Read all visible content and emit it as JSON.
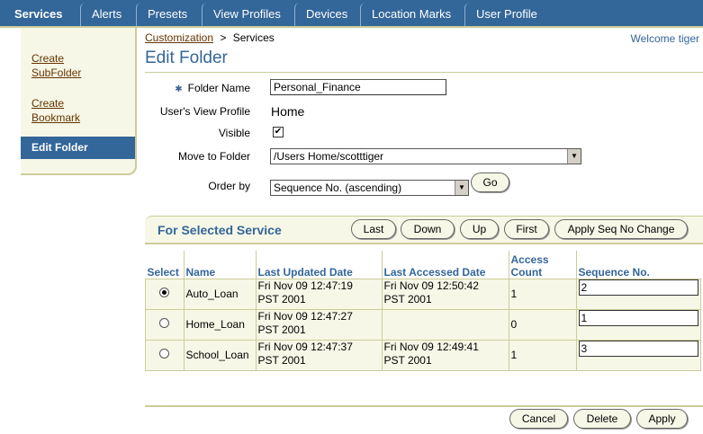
{
  "tabs": [
    {
      "label": "Services",
      "active": true
    },
    {
      "label": "Alerts"
    },
    {
      "label": "Presets"
    },
    {
      "label": "View Profiles"
    },
    {
      "label": "Devices"
    },
    {
      "label": "Location Marks"
    },
    {
      "label": "User Profile"
    }
  ],
  "sidenav": {
    "create_subfolder_1": "Create",
    "create_subfolder_2": "SubFolder",
    "create_bookmark_1": "Create",
    "create_bookmark_2": "Bookmark",
    "active": "Edit Folder"
  },
  "breadcrumb": {
    "link": "Customization",
    "sep": ">",
    "current": "Services"
  },
  "welcome": "Welcome tiger",
  "page_title": "Edit Folder",
  "form": {
    "folder_name_label": "Folder Name",
    "folder_name_value": "Personal_Finance",
    "view_profile_label": "User's View Profile",
    "view_profile_value": "Home",
    "visible_label": "Visible",
    "visible_checked": "✔",
    "move_label": "Move to Folder",
    "move_value": "/Users Home/scotttiger",
    "order_label": "Order by",
    "order_value": "Sequence No. (ascending)",
    "go_label": "Go"
  },
  "service_bar": {
    "title": "For Selected Service",
    "last": "Last",
    "down": "Down",
    "up": "Up",
    "first": "First",
    "apply_seq": "Apply Seq No Change"
  },
  "table": {
    "headers": {
      "select": "Select",
      "name": "Name",
      "updated": "Last Updated Date",
      "accessed": "Last Accessed Date",
      "count_1": "Access",
      "count_2": "Count",
      "seq": "Sequence No."
    },
    "rows": [
      {
        "name": "Auto_Loan",
        "updated_1": "Fri Nov 09 12:47:19",
        "updated_2": "PST 2001",
        "accessed_1": "Fri Nov 09 12:50:42",
        "accessed_2": "PST 2001",
        "count": "1",
        "seq": "2"
      },
      {
        "name": "Home_Loan",
        "updated_1": "Fri Nov 09 12:47:27",
        "updated_2": "PST 2001",
        "accessed_1": "",
        "accessed_2": "",
        "count": "0",
        "seq": "1"
      },
      {
        "name": "School_Loan",
        "updated_1": "Fri Nov 09 12:47:37",
        "updated_2": "PST 2001",
        "accessed_1": "Fri Nov 09 12:49:41",
        "accessed_2": "PST 2001",
        "count": "1",
        "seq": "3"
      }
    ]
  },
  "footer": {
    "cancel": "Cancel",
    "delete": "Delete",
    "apply": "Apply"
  }
}
